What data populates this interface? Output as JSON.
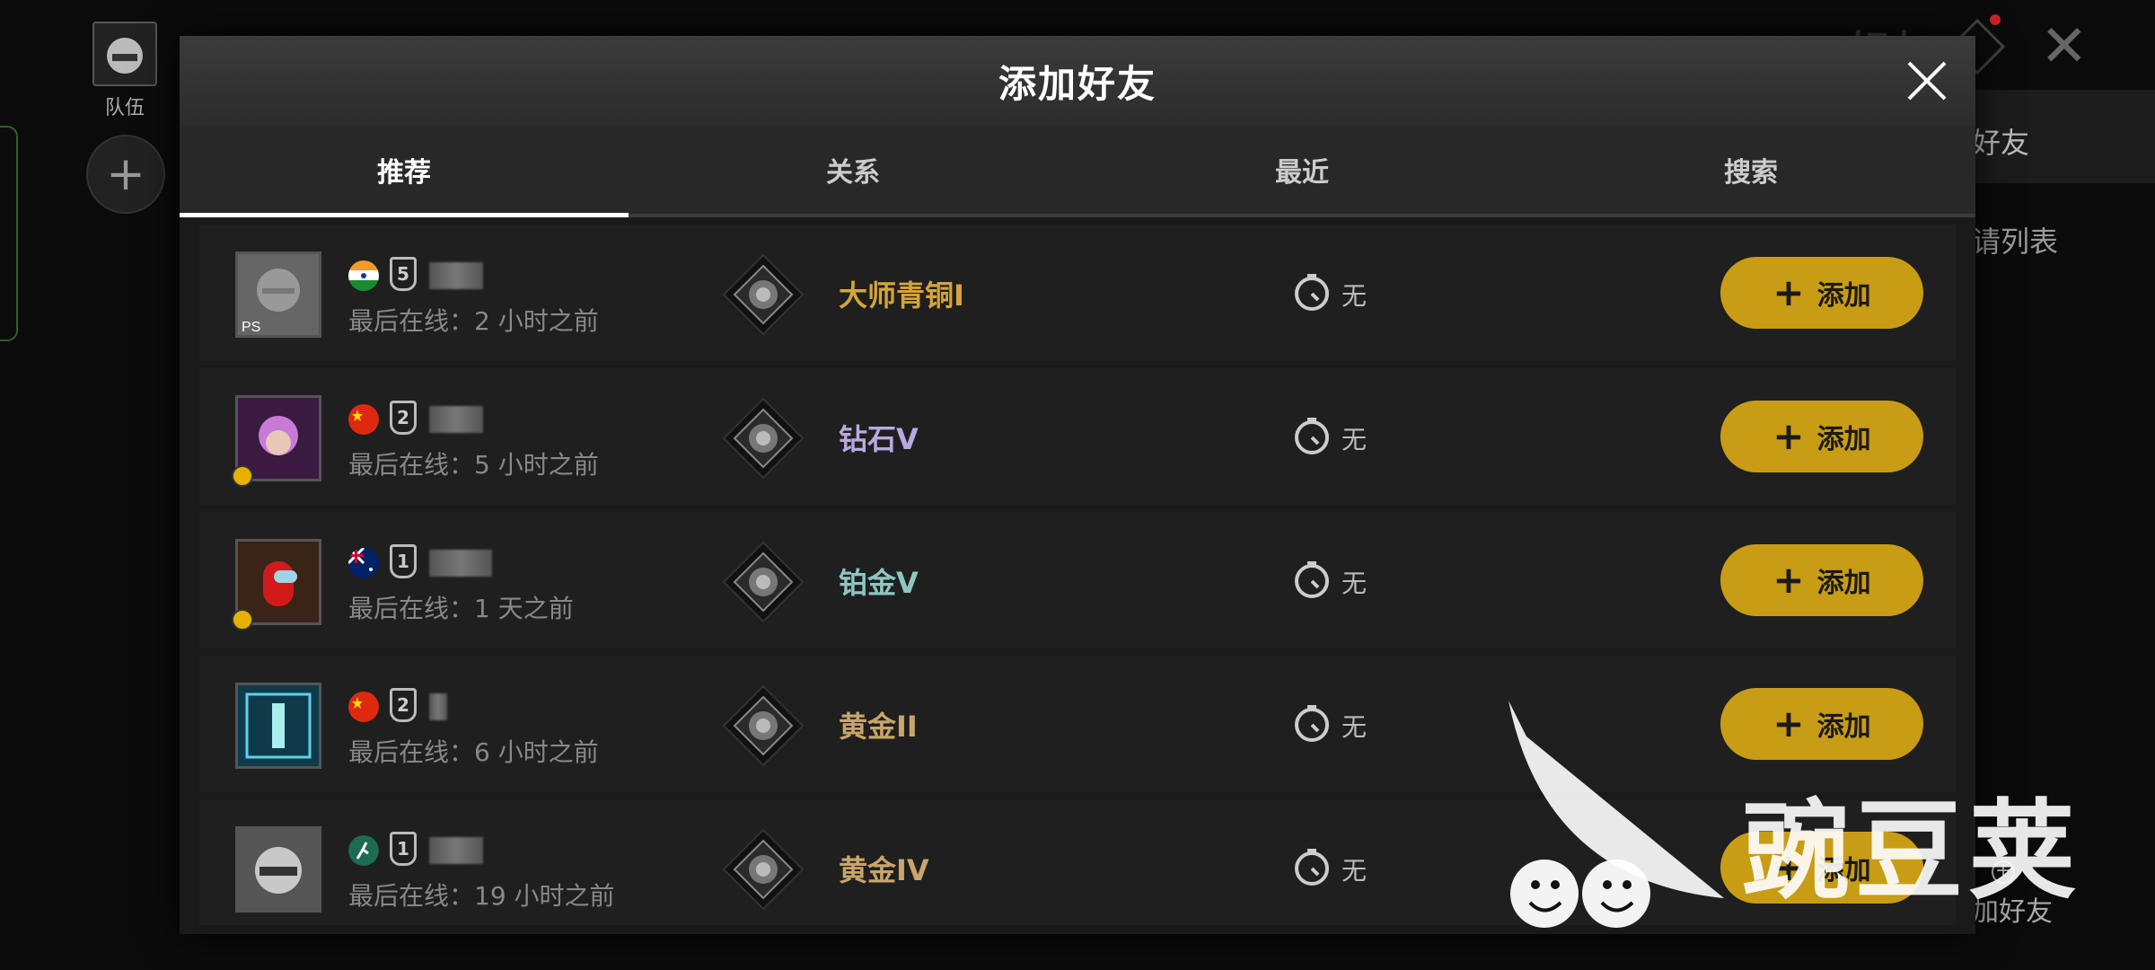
{
  "background": {
    "team_label": "队伍",
    "right_title": "好友",
    "side_tab": "好友",
    "side_text": "请列表",
    "add_friend": "加好友"
  },
  "modal": {
    "title": "添加好友",
    "tabs": [
      {
        "label": "推荐",
        "active": true
      },
      {
        "label": "关系",
        "active": false
      },
      {
        "label": "最近",
        "active": false
      },
      {
        "label": "搜索",
        "active": false
      }
    ]
  },
  "players": [
    {
      "flag": "india",
      "level": "5",
      "last_online": "最后在线：2 小时之前",
      "rank": "大师青铜I",
      "rank_color": "#d4a53a",
      "time": "无",
      "add_label": "添加",
      "avatar": "ps-ghost-icon"
    },
    {
      "flag": "china",
      "level": "2",
      "last_online": "最后在线：5 小时之前",
      "rank": "钻石V",
      "rank_color": "#b9a9e0",
      "time": "无",
      "add_label": "添加",
      "avatar": "purple-hair-avatar"
    },
    {
      "flag": "australia",
      "level": "1",
      "last_online": "最后在线：1 天之前",
      "rank": "铂金V",
      "rank_color": "#8fc6c0",
      "time": "无",
      "add_label": "添加",
      "avatar": "crewmate-avatar"
    },
    {
      "flag": "china",
      "level": "2",
      "last_online": "最后在线：6 小时之前",
      "rank": "黄金II",
      "rank_color": "#c9a56a",
      "time": "无",
      "add_label": "添加",
      "avatar": "tech-avatar"
    },
    {
      "flag": "running-man",
      "level": "1",
      "last_online": "最后在线：19 小时之前",
      "rank": "黄金IV",
      "rank_color": "#c9a56a",
      "time": "无",
      "add_label": "添加",
      "avatar": "helmet-avatar"
    }
  ],
  "watermark": "豌豆荚",
  "colors": {
    "accent": "#c89c14",
    "panel": "#1a1a1a"
  }
}
